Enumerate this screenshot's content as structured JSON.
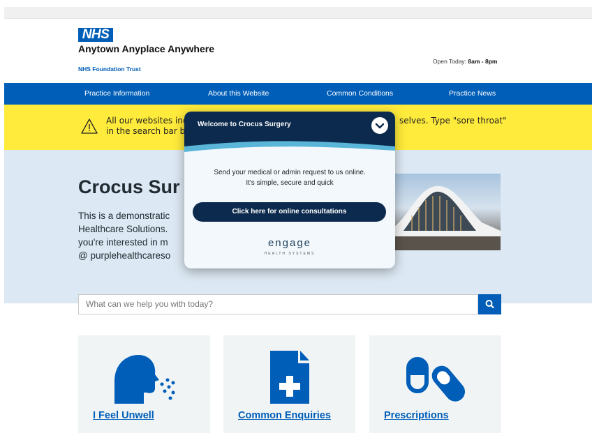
{
  "header": {
    "logo": "NHS",
    "org_name": "Anytown Anyplace Anywhere",
    "org_sub": "NHS Foundation Trust",
    "open_label": "Open Today:",
    "open_hours": "8am - 8pm"
  },
  "nav": {
    "items": [
      "Practice Information",
      "About this Website",
      "Common Conditions",
      "Practice News"
    ]
  },
  "alert": {
    "text_left_1": "All our websites inclu",
    "text_left_2": "in the search bar belo",
    "text_right": "selves.  Type \"sore throat\""
  },
  "hero": {
    "title": "Crocus Sur",
    "line1": "This is a demonstratic",
    "line2": "Healthcare Solutions.",
    "line3": "you're interested in m",
    "line4": "@ purplehealthcareso"
  },
  "search": {
    "placeholder": "What can we help you with today?"
  },
  "cards": [
    {
      "label": "I Feel Unwell",
      "icon": "sick-person-icon"
    },
    {
      "label": "Common Enquiries",
      "icon": "document-plus-icon"
    },
    {
      "label": "Prescriptions",
      "icon": "pills-icon"
    }
  ],
  "popup": {
    "title": "Welcome to Crocus Surgery",
    "body_line1": "Send your medical or admin request to us online.",
    "body_line2": "It's simple, secure and quick",
    "button": "Click here for online consultations",
    "brand": "engage",
    "brand_sub": "HEALTH SYSTEMS"
  },
  "colors": {
    "nhs_blue": "#005eb8",
    "alert_yellow": "#ffeb3b",
    "hero_bg": "#dce8f3",
    "popup_dark": "#0c2a4d"
  }
}
